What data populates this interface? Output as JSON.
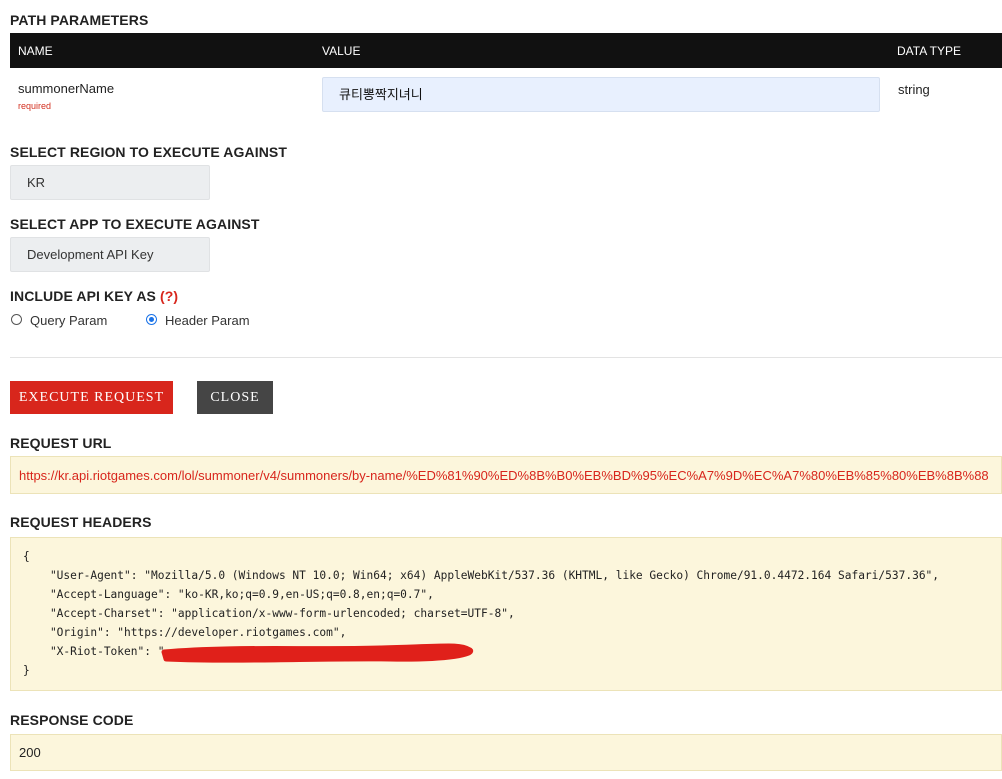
{
  "path_parameters": {
    "title": "PATH PARAMETERS",
    "columns": [
      "NAME",
      "VALUE",
      "DATA TYPE"
    ],
    "row": {
      "name": "summonerName",
      "required": "required",
      "value": "큐티뽕짝지녀니",
      "data_type": "string"
    }
  },
  "region": {
    "title": "SELECT REGION TO EXECUTE AGAINST",
    "selected": "KR"
  },
  "app": {
    "title": "SELECT APP TO EXECUTE AGAINST",
    "selected": "Development API Key"
  },
  "api_key": {
    "title": "INCLUDE API KEY AS",
    "help": "(?)",
    "options": [
      {
        "label": "Query Param",
        "checked": false
      },
      {
        "label": "Header Param",
        "checked": true
      }
    ]
  },
  "buttons": {
    "execute": "EXECUTE REQUEST",
    "close": "CLOSE"
  },
  "request_url": {
    "title": "REQUEST URL",
    "value": "https://kr.api.riotgames.com/lol/summoner/v4/summoners/by-name/%ED%81%90%ED%8B%B0%EB%BD%95%EC%A7%9D%EC%A7%80%EB%85%80%EB%8B%88"
  },
  "request_headers": {
    "title": "REQUEST HEADERS",
    "lines": [
      "{",
      "    \"User-Agent\": \"Mozilla/5.0 (Windows NT 10.0; Win64; x64) AppleWebKit/537.36 (KHTML, like Gecko) Chrome/91.0.4472.164 Safari/537.36\",",
      "    \"Accept-Language\": \"ko-KR,ko;q=0.9,en-US;q=0.8,en;q=0.7\",",
      "    \"Accept-Charset\": \"application/x-www-form-urlencoded; charset=UTF-8\",",
      "    \"Origin\": \"https://developer.riotgames.com\",",
      "    \"X-Riot-Token\": \"",
      "}"
    ],
    "redaction_color": "#e0201a"
  },
  "response_code": {
    "title": "RESPONSE CODE",
    "value": "200"
  },
  "colors": {
    "accent_red": "#d8261c",
    "header_black": "#111111",
    "result_bg": "#fcf6dc",
    "input_bg": "#e8f0fe",
    "radio_blue": "#1a73e8"
  }
}
